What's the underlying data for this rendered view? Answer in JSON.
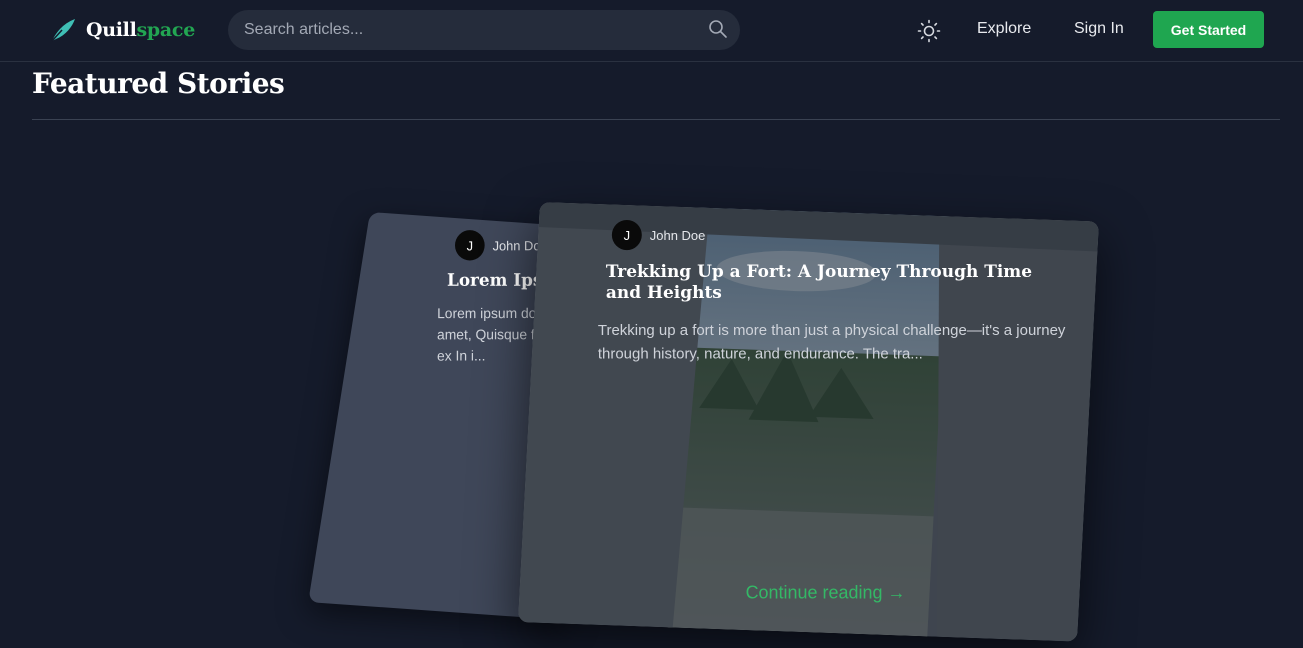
{
  "brand": {
    "name_part1": "Quill",
    "name_part2": "space"
  },
  "search": {
    "placeholder": "Search articles..."
  },
  "nav": {
    "explore": "Explore",
    "sign_in": "Sign In",
    "get_started": "Get Started"
  },
  "section": {
    "title": "Featured Stories"
  },
  "cards": [
    {
      "author_initial": "J",
      "author": "John Doe",
      "title": "Lorem Ipsum",
      "excerpt": "Lorem ipsum dolor sit amet, Quisque faucibus ex In i..."
    },
    {
      "author_initial": "J",
      "author": "John Doe",
      "title": "Trekking Up a Fort: A Journey Through Time and Heights",
      "excerpt": "Trekking up a fort is more than just a physical challenge—it's a journey through history, nature, and endurance. The tra...",
      "cta": "Continue reading →"
    }
  ],
  "colors": {
    "accent": "#1fa650",
    "background": "#151b2b",
    "card_back": "#3f4759"
  }
}
